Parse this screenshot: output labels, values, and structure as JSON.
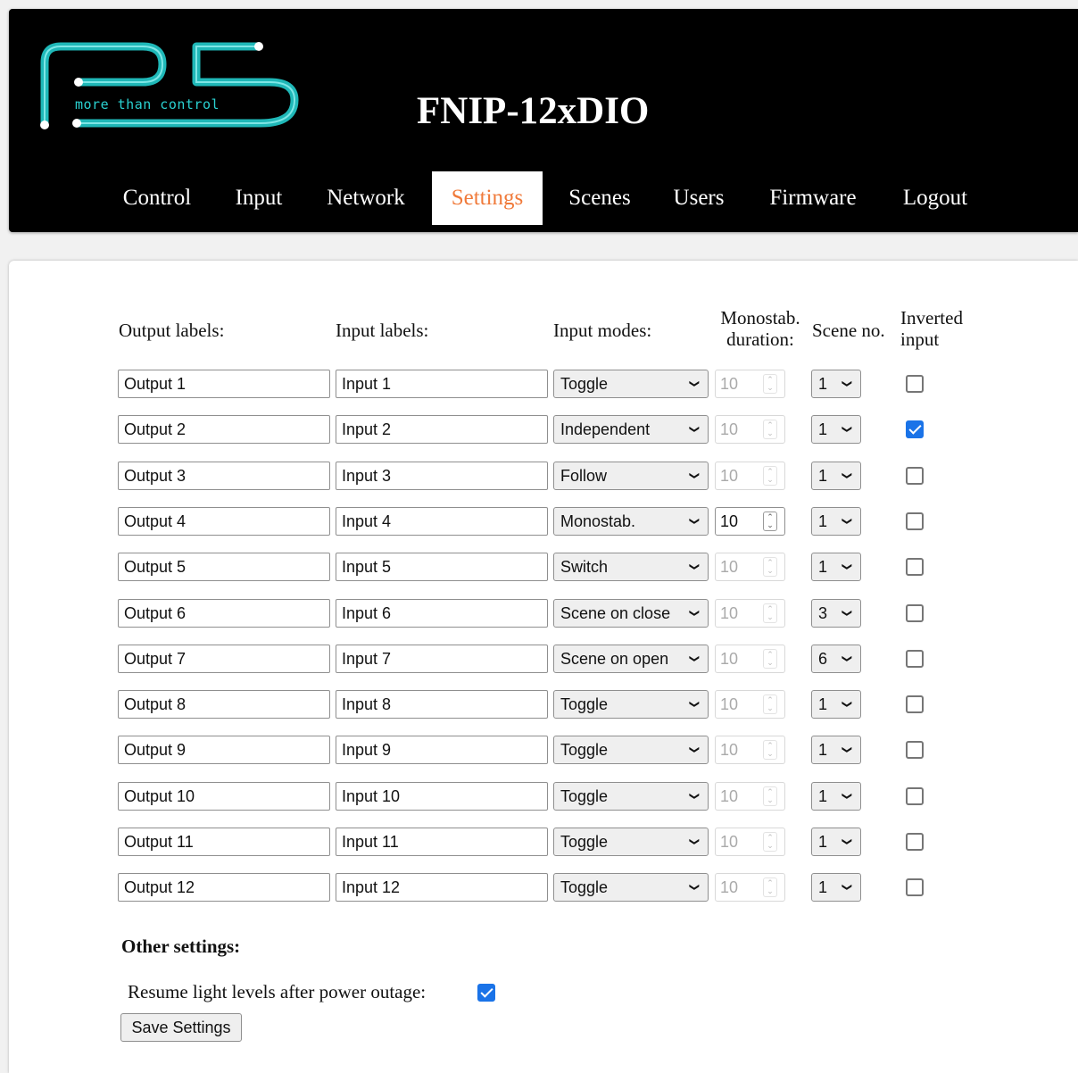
{
  "header": {
    "logo_text": "more than control",
    "device_title": "FNIP-12xDIO",
    "nav": [
      {
        "label": "Control"
      },
      {
        "label": "Input"
      },
      {
        "label": "Network"
      },
      {
        "label": "Settings",
        "active": true
      },
      {
        "label": "Scenes"
      },
      {
        "label": "Users"
      },
      {
        "label": "Firmware"
      },
      {
        "label": "Logout"
      }
    ]
  },
  "colors": {
    "header_bg": "#000000",
    "logo_accent": "#2ad1d1",
    "active_tab_text": "#f07a3a",
    "checkbox_checked": "#1a73e8"
  },
  "settings": {
    "headers": {
      "output_labels": "Output labels:",
      "input_labels": "Input labels:",
      "input_modes": "Input modes:",
      "monostab_line1": "Monostab.",
      "monostab_line2": "duration:",
      "scene_no": "Scene no.",
      "inverted_line1": "Inverted",
      "inverted_line2": "input"
    },
    "rows": [
      {
        "output": "Output 1",
        "input": "Input 1",
        "mode": "Toggle",
        "duration": "10",
        "duration_enabled": false,
        "scene": "1",
        "inverted": false
      },
      {
        "output": "Output 2",
        "input": "Input 2",
        "mode": "Independent",
        "duration": "10",
        "duration_enabled": false,
        "scene": "1",
        "inverted": true
      },
      {
        "output": "Output 3",
        "input": "Input 3",
        "mode": "Follow",
        "duration": "10",
        "duration_enabled": false,
        "scene": "1",
        "inverted": false
      },
      {
        "output": "Output 4",
        "input": "Input 4",
        "mode": "Monostab.",
        "duration": "10",
        "duration_enabled": true,
        "scene": "1",
        "inverted": false
      },
      {
        "output": "Output 5",
        "input": "Input 5",
        "mode": "Switch",
        "duration": "10",
        "duration_enabled": false,
        "scene": "1",
        "inverted": false
      },
      {
        "output": "Output 6",
        "input": "Input 6",
        "mode": "Scene on close",
        "duration": "10",
        "duration_enabled": false,
        "scene": "3",
        "inverted": false
      },
      {
        "output": "Output 7",
        "input": "Input 7",
        "mode": "Scene on open",
        "duration": "10",
        "duration_enabled": false,
        "scene": "6",
        "inverted": false
      },
      {
        "output": "Output 8",
        "input": "Input 8",
        "mode": "Toggle",
        "duration": "10",
        "duration_enabled": false,
        "scene": "1",
        "inverted": false
      },
      {
        "output": "Output 9",
        "input": "Input 9",
        "mode": "Toggle",
        "duration": "10",
        "duration_enabled": false,
        "scene": "1",
        "inverted": false
      },
      {
        "output": "Output 10",
        "input": "Input 10",
        "mode": "Toggle",
        "duration": "10",
        "duration_enabled": false,
        "scene": "1",
        "inverted": false
      },
      {
        "output": "Output 11",
        "input": "Input 11",
        "mode": "Toggle",
        "duration": "10",
        "duration_enabled": false,
        "scene": "1",
        "inverted": false
      },
      {
        "output": "Output 12",
        "input": "Input 12",
        "mode": "Toggle",
        "duration": "10",
        "duration_enabled": false,
        "scene": "1",
        "inverted": false
      }
    ]
  },
  "other": {
    "title": "Other settings:",
    "resume_label": "Resume light levels after power outage:",
    "resume_checked": true,
    "save_label": "Save Settings"
  }
}
